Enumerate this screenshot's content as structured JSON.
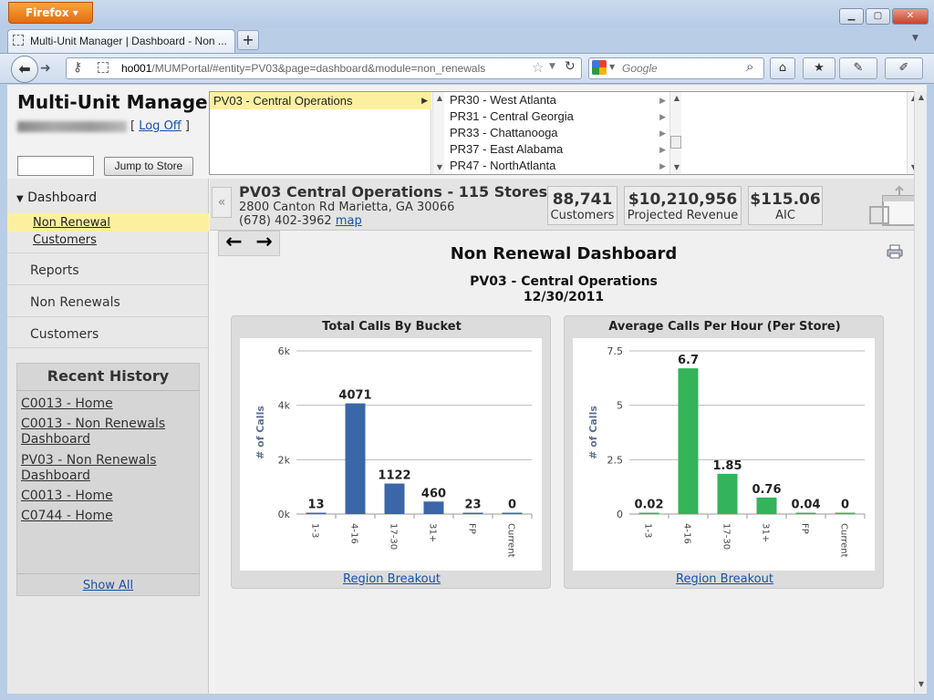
{
  "browser": {
    "button_label": "Firefox ▾",
    "tab_title": "Multi-Unit Manager | Dashboard - Non ...",
    "url_host": "ho001",
    "url_rest": "/MUMPortal/#entity=PV03&page=dashboard&module=non_renewals",
    "search_placeholder": "Google"
  },
  "app": {
    "title": "Multi-Unit Manager",
    "logoff_open": "[",
    "logoff_label": "Log Off",
    "logoff_close": "]",
    "jump_label": "Jump to Store"
  },
  "selector": {
    "active": "PV03 - Central Operations",
    "subitems": [
      "PR30 - West Atlanta",
      "PR31 - Central Georgia",
      "PR33 - Chattanooga",
      "PR37 - East Alabama",
      "PR47 - NorthAtlanta"
    ]
  },
  "sidebar": {
    "dashboard": "Dashboard",
    "sublinks": [
      "Non Renewal",
      "Customers"
    ],
    "items": [
      "Reports",
      "Non Renewals",
      "Customers"
    ],
    "history_title": "Recent History",
    "history": [
      "C0013 - Home",
      "C0013 - Non Renewals Dashboard",
      "PV03 - Non Renewals Dashboard",
      "C0013 - Home",
      "C0744 - Home"
    ],
    "show_all": "Show All"
  },
  "entity": {
    "title": "PV03 Central Operations - 115 Stores",
    "address": "2800 Canton Rd Marietta, GA 30066",
    "phone": "(678) 402-3962",
    "map": "map",
    "stats": [
      {
        "value": "88,741",
        "label": "Customers"
      },
      {
        "value": "$10,210,956",
        "label": "Projected Revenue"
      },
      {
        "value": "$115.06",
        "label": "AIC"
      }
    ]
  },
  "main": {
    "title": "Non Renewal Dashboard",
    "sub1": "PV03 - Central Operations",
    "sub2": "12/30/2011",
    "region_link": "Region Breakout"
  },
  "chart_data": [
    {
      "type": "bar",
      "title": "Total Calls By Bucket",
      "ylabel": "# of Calls",
      "categories": [
        "1-3",
        "4-16",
        "17-30",
        "31+",
        "FP",
        "Current"
      ],
      "values": [
        13,
        4071,
        1122,
        460,
        23,
        0
      ],
      "labels": [
        "13",
        "4071",
        "1122",
        "460",
        "23",
        "0"
      ],
      "ylim": [
        0,
        6000
      ],
      "yticks": [
        0,
        2000,
        4000,
        6000
      ],
      "ytick_labels": [
        "0k",
        "2k",
        "4k",
        "6k"
      ],
      "color": "#3b66a8"
    },
    {
      "type": "bar",
      "title": "Average Calls Per Hour (Per Store)",
      "ylabel": "# of Calls",
      "categories": [
        "1-3",
        "4-16",
        "17-30",
        "31+",
        "FP",
        "Current"
      ],
      "values": [
        0.02,
        6.7,
        1.85,
        0.76,
        0.04,
        0
      ],
      "labels": [
        "0.02",
        "6.7",
        "1.85",
        "0.76",
        "0.04",
        "0"
      ],
      "ylim": [
        0,
        7.5
      ],
      "yticks": [
        0,
        2.5,
        5,
        7.5
      ],
      "ytick_labels": [
        "0",
        "2.5",
        "5",
        "7.5"
      ],
      "color": "#33b35a"
    }
  ]
}
